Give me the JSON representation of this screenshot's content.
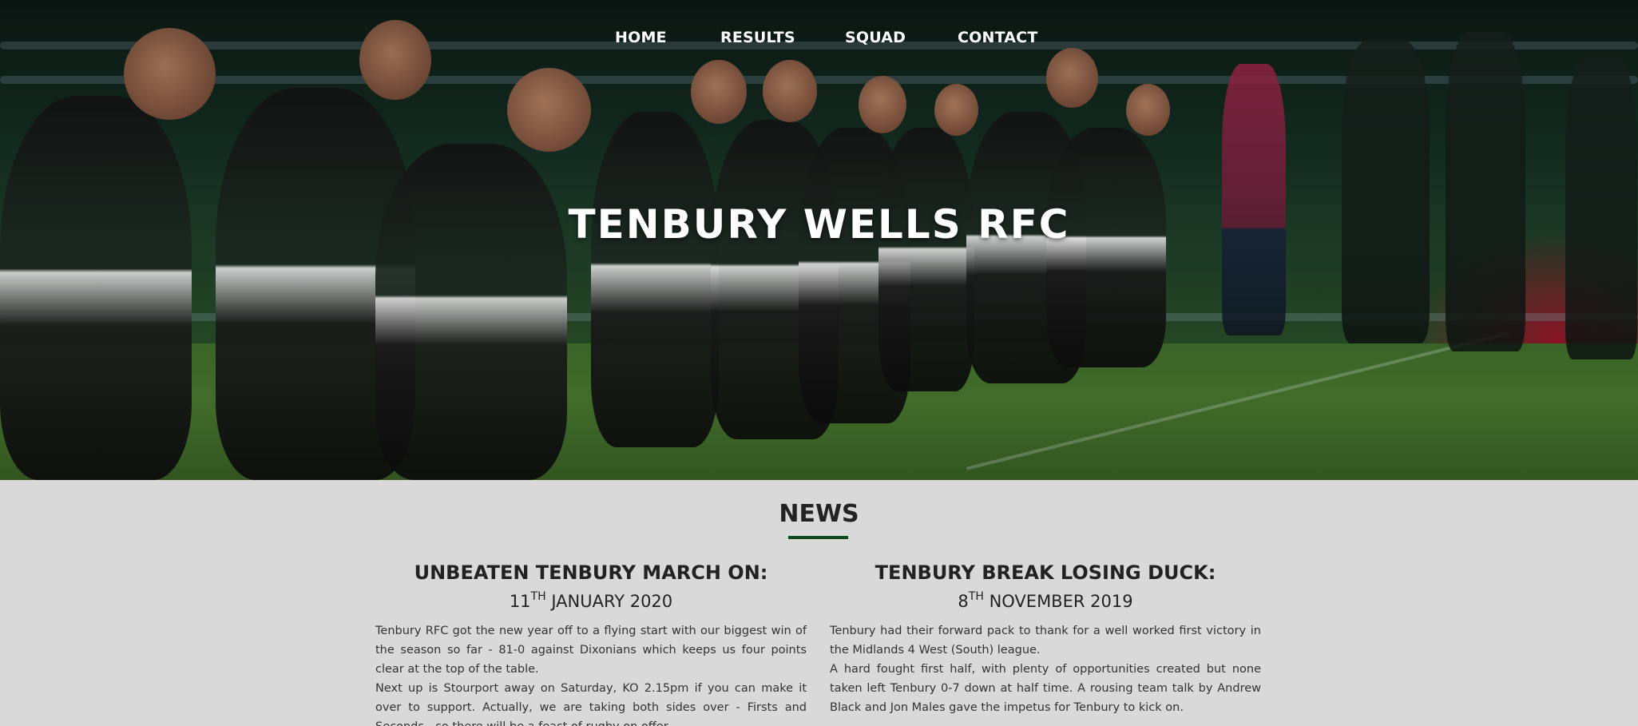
{
  "nav": {
    "items": [
      {
        "label": "HOME"
      },
      {
        "label": "RESULTS"
      },
      {
        "label": "SQUAD"
      },
      {
        "label": "CONTACT"
      }
    ]
  },
  "hero": {
    "title": "TENBURY WELLS RFC",
    "image_icon": "rugby-players-photo"
  },
  "news": {
    "heading": "NEWS",
    "accent_color": "#0c4a1d",
    "articles": [
      {
        "title": "UNBEATEN TENBURY MARCH ON:",
        "date_day": "11",
        "date_suffix": "TH",
        "date_rest": "JANUARY 2020",
        "paragraphs": [
          "Tenbury RFC got the new year off to a flying start with our biggest win of the season so far - 81-0 against Dixonians which keeps us four points clear at the top of the table.",
          "Next up is Stourport away on Saturday, KO 2.15pm if you can make it over to support. Actually, we are taking both sides over - Firsts and Seconds - so there will be a feast of rugby on offer."
        ]
      },
      {
        "title": "TENBURY BREAK LOSING DUCK:",
        "date_day": "8",
        "date_suffix": "TH",
        "date_rest": "NOVEMBER 2019",
        "paragraphs": [
          "Tenbury had their forward pack to thank for a well worked first victory in the Midlands 4 West (South) league.",
          "A hard fought first half, with plenty of opportunities created but none taken left Tenbury 0-7 down at half time. A rousing team talk by Andrew Black and Jon Males gave the impetus for Tenbury to kick on."
        ]
      }
    ]
  }
}
